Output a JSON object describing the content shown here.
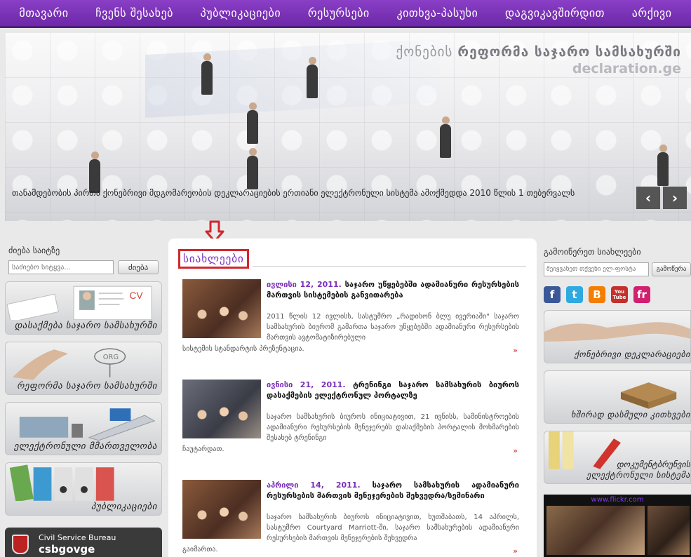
{
  "nav": {
    "items": [
      "მთავარი",
      "ჩვენს შესახებ",
      "პუბლიკაციები",
      "რესურსები",
      "კითხვა-პასუხი",
      "დაგვიკავშირდით",
      "არქივი"
    ]
  },
  "hero": {
    "brand_line1_prefix": "ქონების",
    "brand_line1_main": "რეფორმა საჯარო სამსახურში",
    "brand_line2": "declaration.ge",
    "caption": "თანამდებობის პირთა ქონებრივი მდგომარეობის დეკლარაციების ერთიანი ელექტრონული სისტემა ამოქმედდა 2010 წლის 1 თებერვალს",
    "prev": "‹",
    "next": "›"
  },
  "left": {
    "search_title": "ძიება საიტზე",
    "search_placeholder": "საძიებო სიტყვა...",
    "search_button": "ძიება",
    "tiles": [
      "დასაქმება საჯარო სამსახურში",
      "რეფორმა საჯარო სამსახურში",
      "ელექტრონული მმართველობა",
      "პუბლიკაციები"
    ],
    "tile_cv_text": "CV",
    "csb_line1": "Civil Service Bureau",
    "csb_line2": "csbgovge"
  },
  "news": {
    "heading": "სიახლეები",
    "more": "»",
    "items": [
      {
        "date": "ივლისი 12, 2011.",
        "title": "საჯარო უწყებებში ადამიანური რესურსების მართვის სისტემების განვითარება",
        "body": "2011 წლის 12 ივლისს, სასტუმრო „რადისონ ბლუ ივერიაში\" საჯარო სამსახურის ბიურომ გამართა საჯარო უწყებებში ადამიანური რესურსების მართვის ავტომატიზირებული",
        "tail": "სისტემის სტანდარტის პრეზენტაცია."
      },
      {
        "date": "ივნისი 21, 2011.",
        "title": "ტრენინგი საჯარო სამსახურის ბიუროს დასაქმების ელექტრონულ პორტალზე",
        "body": "საჯარო სამსახურის ბიუროს ინიციატივით, 21 ივნისს, სამინისტროების ადამიანური რესურსების მენეჯერებს დასაქმების პორტალის მოხმარების შესახებ ტრენინგი",
        "tail": "ჩაუტარდათ."
      },
      {
        "date": "აპრილი 14, 2011.",
        "title": "საჯარო სამსახურის ადამიანური რესურსების მართვის მენეჯერების შეხვედრა/სემინარი",
        "body": "საჯარო სამსახურის ბიუროს ინიციატივით, ხუთშაბათს, 14 აპრილს, სასტუმრო Courtyard Marriott-ში, საჯარო სამსახურების ადამიანური რესურსების მართვის მენეჯერების შეხვედრა",
        "tail": "გაიმართა."
      }
    ]
  },
  "right": {
    "subscribe_title": "გამოიწერეთ სიახლეები",
    "subscribe_placeholder": "შეიყვანეთ თქვენი ელ-ფოსტა",
    "subscribe_button": "გამოწერა",
    "social": [
      "f",
      "t",
      "B",
      "You Tube",
      "fr"
    ],
    "tiles": [
      {
        "label": "ქონებრივი დეკლარაციები"
      },
      {
        "label": "ხშირად დასმული კითხვები"
      },
      {
        "label_top": "დოკუმენტბრუნვის",
        "label": "ელექტრონული სისტემა"
      }
    ],
    "flickr_tag": "www.flickr.com"
  },
  "colors": {
    "nav": "#6d28a8",
    "accent_purple": "#7a2fb8",
    "highlight_red": "#d3262d"
  }
}
